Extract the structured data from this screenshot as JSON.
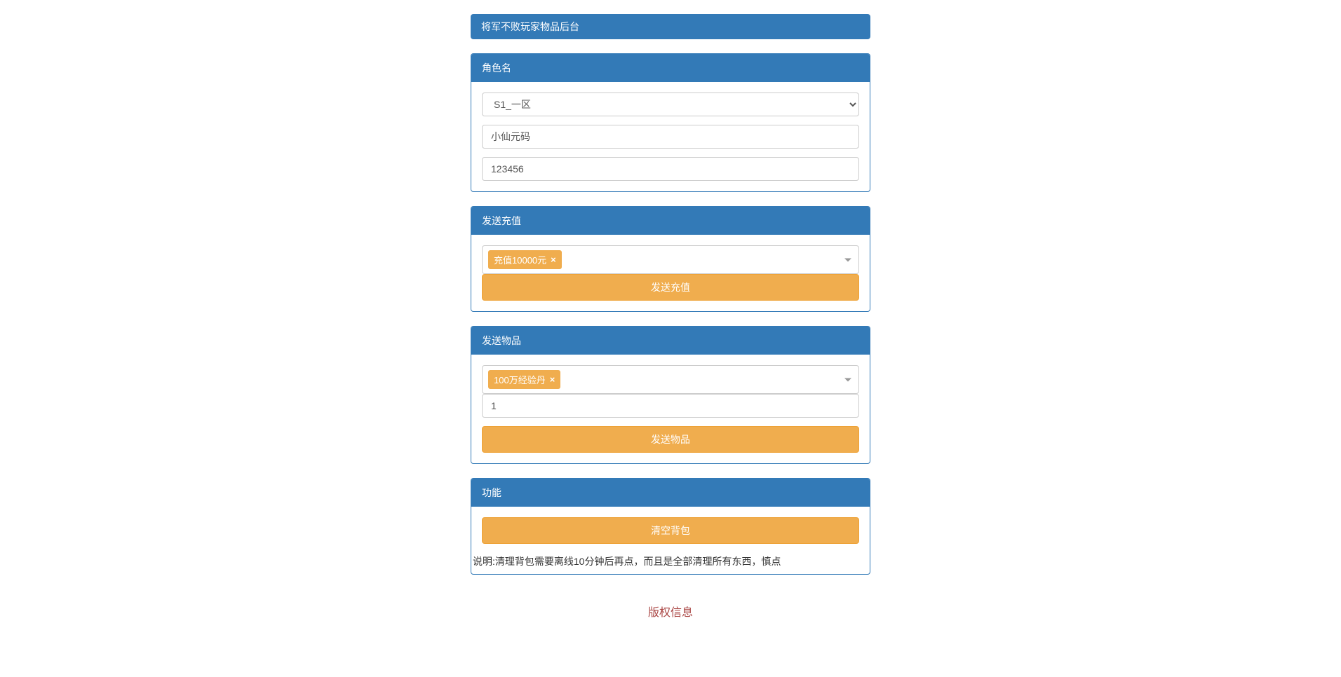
{
  "header": {
    "title": "将军不败玩家物品后台"
  },
  "role_panel": {
    "heading": "角色名",
    "server_select": "S1_一区",
    "name_value": "小仙元码",
    "id_value": "123456"
  },
  "recharge_panel": {
    "heading": "发送充值",
    "selected_tag": "充值10000元",
    "submit_label": "发送充值"
  },
  "item_panel": {
    "heading": "发送物品",
    "selected_tag": "100万经验丹",
    "quantity_value": "1",
    "submit_label": "发送物品"
  },
  "function_panel": {
    "heading": "功能",
    "clear_bag_label": "清空背包",
    "note": "说明:清理背包需要离线10分钟后再点，而且是全部清理所有东西，慎点"
  },
  "footer": {
    "copyright": "版权信息"
  }
}
